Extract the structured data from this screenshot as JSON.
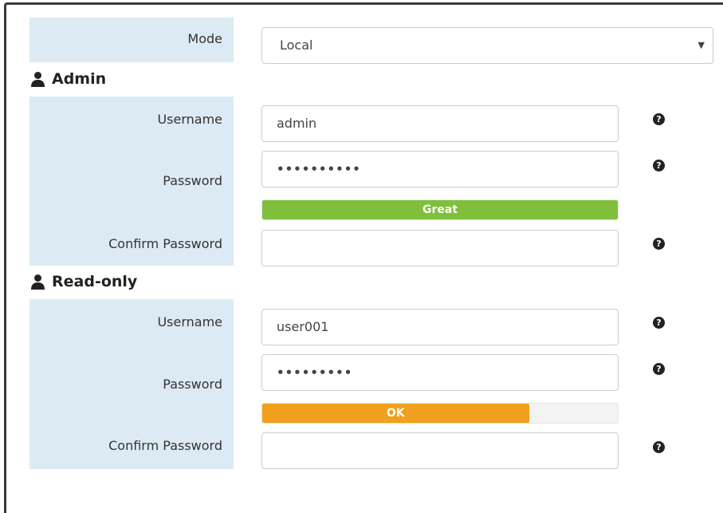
{
  "mode": {
    "label": "Mode",
    "value": "Local"
  },
  "admin": {
    "title": "Admin",
    "username_label": "Username",
    "username_value": "admin",
    "password_label": "Password",
    "password_value": "••••••••••",
    "strength_label": "Great",
    "strength_fraction": 1.0,
    "strength_color": "#7fbf3a",
    "confirm_label": "Confirm Password",
    "confirm_value": ""
  },
  "readonly": {
    "title": "Read-only",
    "username_label": "Username",
    "username_value": "user001",
    "password_label": "Password",
    "password_value": "•••••••••",
    "strength_label": "OK",
    "strength_fraction": 0.75,
    "strength_color": "#f0a01c",
    "confirm_label": "Confirm Password",
    "confirm_value": ""
  },
  "icons": {
    "help": "?",
    "user": "user-icon"
  }
}
